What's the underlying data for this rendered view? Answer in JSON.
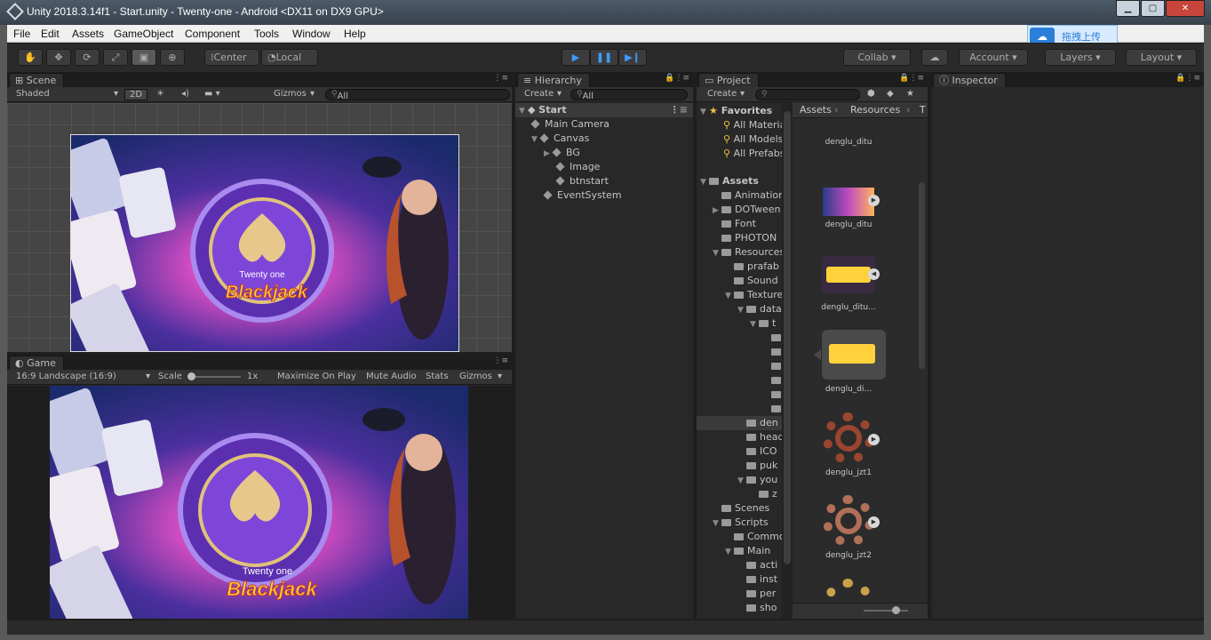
{
  "window": {
    "title": "Unity 2018.3.14f1 - Start.unity - Twenty-one - Android <DX11 on DX9 GPU>"
  },
  "menu": [
    "File",
    "Edit",
    "Assets",
    "GameObject",
    "Component",
    "Tools",
    "Window",
    "Help"
  ],
  "upload": {
    "label": "拖拽上传"
  },
  "toolbar": {
    "center": "Center",
    "local": "Local",
    "collab": "Collab",
    "account": "Account",
    "layers": "Layers",
    "layout": "Layout"
  },
  "scene": {
    "tab": "Scene",
    "shading": "Shaded",
    "mode2d": "2D",
    "gizmos": "Gizmos",
    "search_placeholder": "All"
  },
  "game": {
    "tab": "Game",
    "aspect": "16:9 Landscape (16:9)",
    "scale_label": "Scale",
    "scale_value": "1x",
    "maximize": "Maximize On Play",
    "mute": "Mute Audio",
    "stats": "Stats",
    "gizmos": "Gizmos"
  },
  "artwork": {
    "logo_top": "Twenty one",
    "logo_main": "Blackjack"
  },
  "hierarchy": {
    "tab": "Hierarchy",
    "create": "Create",
    "search_placeholder": "All",
    "scene": "Start",
    "items": [
      "Main Camera",
      "Canvas",
      "BG",
      "Image",
      "btnstart",
      "EventSystem"
    ]
  },
  "project": {
    "tab": "Project",
    "create": "Create",
    "favorites": "Favorites",
    "favorite_items": [
      "All Materials",
      "All Models",
      "All Prefabs"
    ],
    "assets_root": "Assets",
    "tree": [
      "Animation",
      "DOTween",
      "Font",
      "PHOTON",
      "Resources",
      "prafab",
      "Sound",
      "Textures",
      "data",
      "t",
      "",
      "",
      "",
      "",
      "",
      "",
      "den",
      "head",
      "ICO",
      "puk",
      "you",
      "z",
      "Scenes",
      "Scripts",
      "Common",
      "Main",
      "acti",
      "inst",
      "per",
      "sho"
    ],
    "breadcrumb": [
      "Assets",
      "Resources",
      "T"
    ],
    "thumbnails": [
      "denglu_ditu",
      "denglu_ditu",
      "denglu_ditu...",
      "denglu_di...",
      "denglu_jzt1",
      "denglu_jzt2"
    ]
  },
  "inspector": {
    "tab": "Inspector"
  }
}
